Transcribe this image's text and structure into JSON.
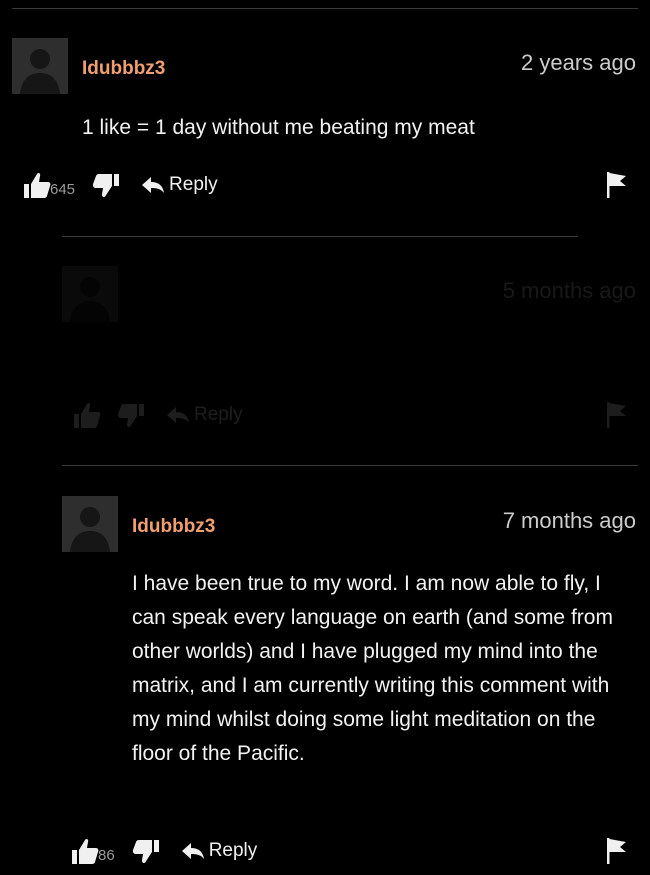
{
  "comments": [
    {
      "username": "Idubbbz3",
      "timestamp": "2 years ago",
      "text": "1 like = 1 day without me beating my meat",
      "likes": "645",
      "reply_label": "Reply"
    },
    {
      "username": "",
      "timestamp": "5 months ago",
      "text": "",
      "likes": "",
      "reply_label": "Reply"
    },
    {
      "username": "Idubbbz3",
      "timestamp": "7 months ago",
      "text": "I have been true to my word. I am now able to fly, I can speak every language on earth (and some from other worlds) and I have plugged my mind into the matrix, and I am currently writing this comment with my mind whilst doing some light meditation on the floor of the Pacific.",
      "likes": "86",
      "reply_label": "Reply"
    }
  ],
  "icons": {
    "like": "thumbs-up-icon",
    "dislike": "thumbs-down-icon",
    "reply": "reply-arrow-icon",
    "flag": "flag-icon",
    "avatar": "default-avatar-icon"
  },
  "colors": {
    "background": "#000000",
    "username": "#f0a070",
    "divider": "#3a3a3a"
  }
}
